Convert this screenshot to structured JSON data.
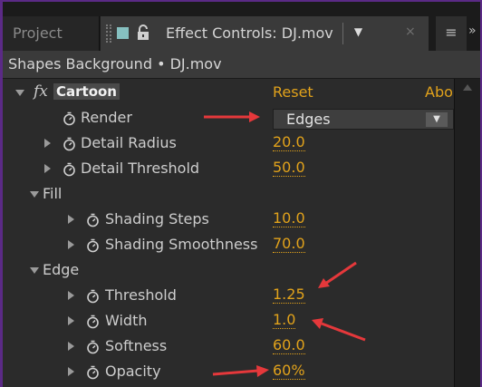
{
  "tabs": {
    "project_label": "Project",
    "effect_controls_label": "Effect Controls: DJ.mov",
    "dropdown_glyph": "▼",
    "close_glyph": "×",
    "menu_glyph": "≡",
    "more_glyph": "»"
  },
  "subtitle": "Shapes Background • DJ.mov",
  "effect": {
    "fx_label": "fx",
    "name": "Cartoon",
    "reset_label": "Reset",
    "about_label": "About..."
  },
  "rows": {
    "render": {
      "label": "Render",
      "value": "Edges"
    },
    "detail_radius": {
      "label": "Detail Radius",
      "value": "20.0"
    },
    "detail_threshold": {
      "label": "Detail Threshold",
      "value": "50.0"
    },
    "fill": {
      "label": "Fill"
    },
    "shading_steps": {
      "label": "Shading Steps",
      "value": "10.0"
    },
    "shading_smoothness": {
      "label": "Shading Smoothness",
      "value": "70.0"
    },
    "edge": {
      "label": "Edge"
    },
    "threshold": {
      "label": "Threshold",
      "value": "1.25"
    },
    "width": {
      "label": "Width",
      "value": "1.0"
    },
    "softness": {
      "label": "Softness",
      "value": "60.0"
    },
    "opacity": {
      "label": "Opacity",
      "value": "60%"
    }
  },
  "select_arrow_glyph": "▼",
  "colors": {
    "accent_value": "#e1a21b",
    "panel_bg": "#2b2b2b",
    "outer_frame": "#5b2a86",
    "annotation_arrow": "#e5383b"
  }
}
